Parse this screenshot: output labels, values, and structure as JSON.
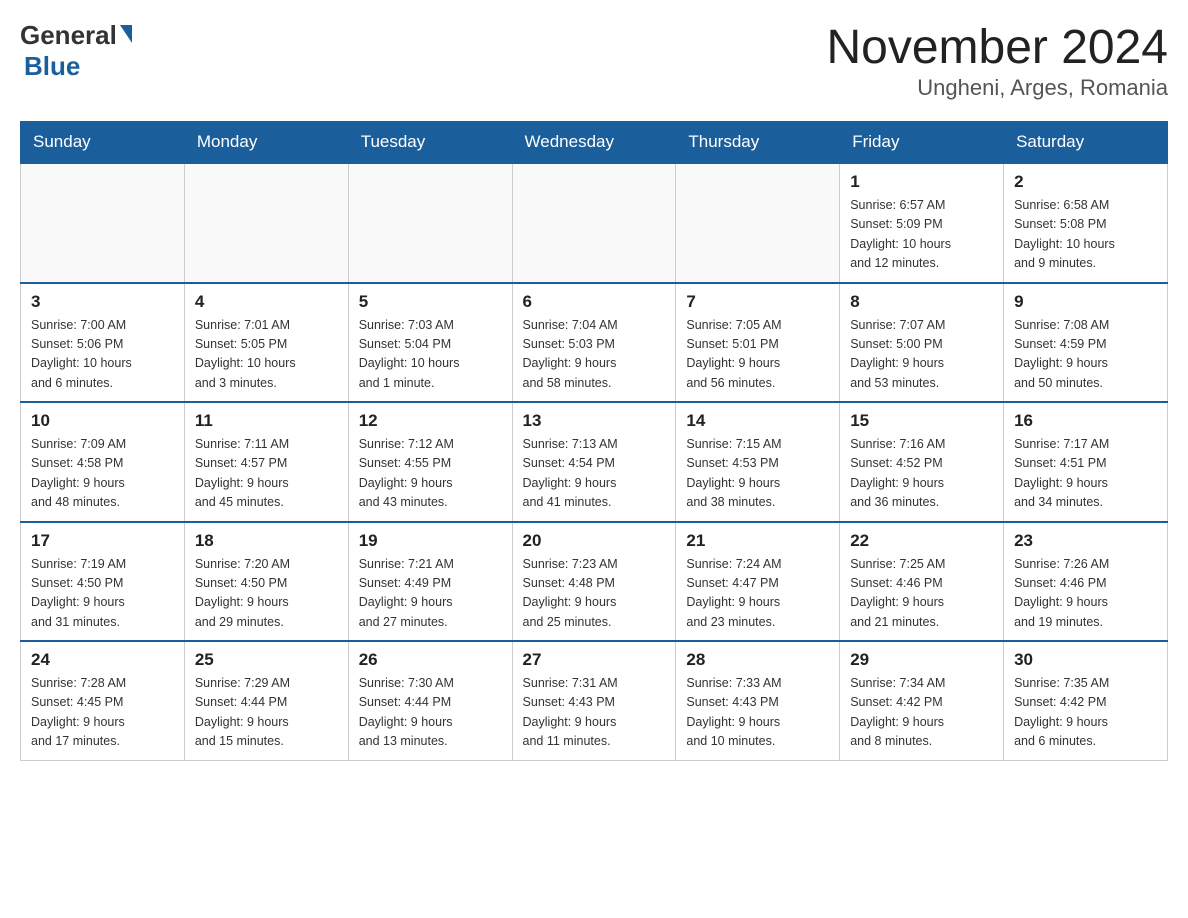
{
  "header": {
    "logo_general": "General",
    "logo_blue": "Blue",
    "month_title": "November 2024",
    "location": "Ungheni, Arges, Romania"
  },
  "weekdays": [
    "Sunday",
    "Monday",
    "Tuesday",
    "Wednesday",
    "Thursday",
    "Friday",
    "Saturday"
  ],
  "weeks": [
    [
      {
        "day": "",
        "info": ""
      },
      {
        "day": "",
        "info": ""
      },
      {
        "day": "",
        "info": ""
      },
      {
        "day": "",
        "info": ""
      },
      {
        "day": "",
        "info": ""
      },
      {
        "day": "1",
        "info": "Sunrise: 6:57 AM\nSunset: 5:09 PM\nDaylight: 10 hours\nand 12 minutes."
      },
      {
        "day": "2",
        "info": "Sunrise: 6:58 AM\nSunset: 5:08 PM\nDaylight: 10 hours\nand 9 minutes."
      }
    ],
    [
      {
        "day": "3",
        "info": "Sunrise: 7:00 AM\nSunset: 5:06 PM\nDaylight: 10 hours\nand 6 minutes."
      },
      {
        "day": "4",
        "info": "Sunrise: 7:01 AM\nSunset: 5:05 PM\nDaylight: 10 hours\nand 3 minutes."
      },
      {
        "day": "5",
        "info": "Sunrise: 7:03 AM\nSunset: 5:04 PM\nDaylight: 10 hours\nand 1 minute."
      },
      {
        "day": "6",
        "info": "Sunrise: 7:04 AM\nSunset: 5:03 PM\nDaylight: 9 hours\nand 58 minutes."
      },
      {
        "day": "7",
        "info": "Sunrise: 7:05 AM\nSunset: 5:01 PM\nDaylight: 9 hours\nand 56 minutes."
      },
      {
        "day": "8",
        "info": "Sunrise: 7:07 AM\nSunset: 5:00 PM\nDaylight: 9 hours\nand 53 minutes."
      },
      {
        "day": "9",
        "info": "Sunrise: 7:08 AM\nSunset: 4:59 PM\nDaylight: 9 hours\nand 50 minutes."
      }
    ],
    [
      {
        "day": "10",
        "info": "Sunrise: 7:09 AM\nSunset: 4:58 PM\nDaylight: 9 hours\nand 48 minutes."
      },
      {
        "day": "11",
        "info": "Sunrise: 7:11 AM\nSunset: 4:57 PM\nDaylight: 9 hours\nand 45 minutes."
      },
      {
        "day": "12",
        "info": "Sunrise: 7:12 AM\nSunset: 4:55 PM\nDaylight: 9 hours\nand 43 minutes."
      },
      {
        "day": "13",
        "info": "Sunrise: 7:13 AM\nSunset: 4:54 PM\nDaylight: 9 hours\nand 41 minutes."
      },
      {
        "day": "14",
        "info": "Sunrise: 7:15 AM\nSunset: 4:53 PM\nDaylight: 9 hours\nand 38 minutes."
      },
      {
        "day": "15",
        "info": "Sunrise: 7:16 AM\nSunset: 4:52 PM\nDaylight: 9 hours\nand 36 minutes."
      },
      {
        "day": "16",
        "info": "Sunrise: 7:17 AM\nSunset: 4:51 PM\nDaylight: 9 hours\nand 34 minutes."
      }
    ],
    [
      {
        "day": "17",
        "info": "Sunrise: 7:19 AM\nSunset: 4:50 PM\nDaylight: 9 hours\nand 31 minutes."
      },
      {
        "day": "18",
        "info": "Sunrise: 7:20 AM\nSunset: 4:50 PM\nDaylight: 9 hours\nand 29 minutes."
      },
      {
        "day": "19",
        "info": "Sunrise: 7:21 AM\nSunset: 4:49 PM\nDaylight: 9 hours\nand 27 minutes."
      },
      {
        "day": "20",
        "info": "Sunrise: 7:23 AM\nSunset: 4:48 PM\nDaylight: 9 hours\nand 25 minutes."
      },
      {
        "day": "21",
        "info": "Sunrise: 7:24 AM\nSunset: 4:47 PM\nDaylight: 9 hours\nand 23 minutes."
      },
      {
        "day": "22",
        "info": "Sunrise: 7:25 AM\nSunset: 4:46 PM\nDaylight: 9 hours\nand 21 minutes."
      },
      {
        "day": "23",
        "info": "Sunrise: 7:26 AM\nSunset: 4:46 PM\nDaylight: 9 hours\nand 19 minutes."
      }
    ],
    [
      {
        "day": "24",
        "info": "Sunrise: 7:28 AM\nSunset: 4:45 PM\nDaylight: 9 hours\nand 17 minutes."
      },
      {
        "day": "25",
        "info": "Sunrise: 7:29 AM\nSunset: 4:44 PM\nDaylight: 9 hours\nand 15 minutes."
      },
      {
        "day": "26",
        "info": "Sunrise: 7:30 AM\nSunset: 4:44 PM\nDaylight: 9 hours\nand 13 minutes."
      },
      {
        "day": "27",
        "info": "Sunrise: 7:31 AM\nSunset: 4:43 PM\nDaylight: 9 hours\nand 11 minutes."
      },
      {
        "day": "28",
        "info": "Sunrise: 7:33 AM\nSunset: 4:43 PM\nDaylight: 9 hours\nand 10 minutes."
      },
      {
        "day": "29",
        "info": "Sunrise: 7:34 AM\nSunset: 4:42 PM\nDaylight: 9 hours\nand 8 minutes."
      },
      {
        "day": "30",
        "info": "Sunrise: 7:35 AM\nSunset: 4:42 PM\nDaylight: 9 hours\nand 6 minutes."
      }
    ]
  ]
}
